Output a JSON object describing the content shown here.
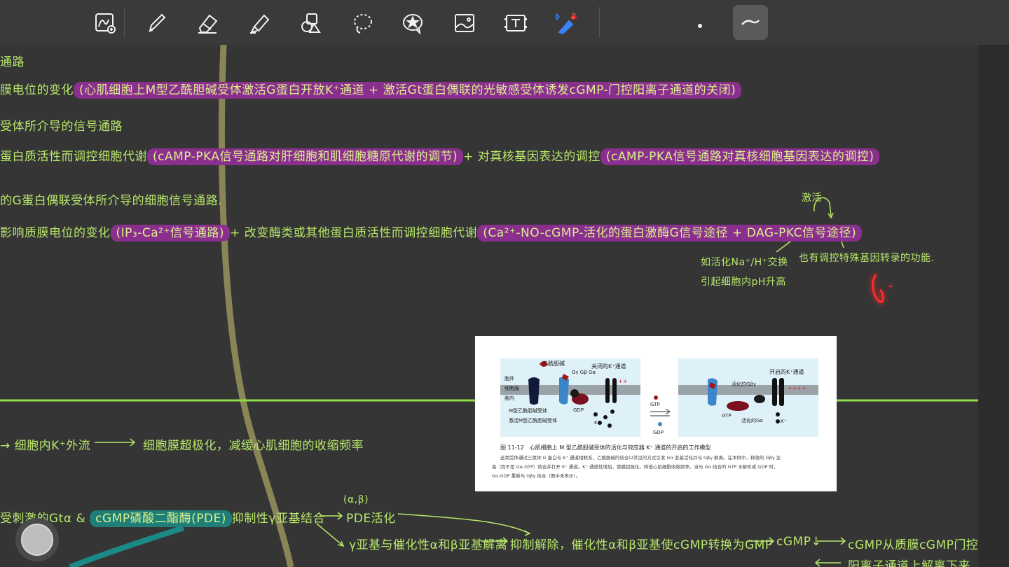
{
  "toolbar": {
    "tools": [
      {
        "name": "lasso-zoom-tool-icon"
      },
      {
        "name": "pen-tool-icon"
      },
      {
        "name": "eraser-tool-icon"
      },
      {
        "name": "highlighter-tool-icon"
      },
      {
        "name": "shapes-tool-icon"
      },
      {
        "name": "lasso-tool-icon"
      },
      {
        "name": "sticker-tool-icon"
      },
      {
        "name": "image-tool-icon"
      },
      {
        "name": "text-tool-icon"
      },
      {
        "name": "laser-pointer-tool-icon"
      }
    ],
    "colors": {
      "background": "#3a3a3a",
      "icon": "#f2f2f2",
      "laser_red": "#ff3b30",
      "laser_blue": "#3b82f6"
    }
  },
  "notes": {
    "line1": "通路",
    "line2_prefix": "膜电位的变化",
    "line2_hl": "(心肌细胞上M型乙酰胆碱受体激活G蛋白开放K⁺通道 + 激活Gt蛋白偶联的光敏感受体诱发cGMP-门控阳离子通道的关闭)",
    "line3": "受体所介导的信号通路",
    "line4_prefix": "蛋白质活性而调控细胞代谢",
    "line4_hl1": "(cAMP-PKA信号通路对肝细胞和肌细胞糖原代谢的调节)",
    "line4_mid": "+ 对真核基因表达的调控",
    "line4_hl2": "(cAMP-PKA信号通路对真核细胞基因表达的调控)",
    "line5": "的G蛋白偶联受体所介导的细胞信号通路.",
    "line6_prefix": "影响质膜电位的变化",
    "line6_hl1": "(IP₃-Ca²⁺信号通路)",
    "line6_mid": "+ 改变酶类或其他蛋白质活性而调控细胞代谢",
    "line6_hl2": "(Ca²⁺-NO-cGMP-活化的蛋白激酶G信号途径 + DAG-PKC信号途径)",
    "activate_label": "激活",
    "branch1_a": "如活化Na⁺/H⁺交换",
    "branch1_b": "引起细胞内pH升高",
    "branch2": "也有调控特殊基因转录的功能.",
    "lower1_a": "→ 细胞内K⁺外流",
    "lower1_b": "细胞膜超极化，减缓心肌细胞的收缩频率",
    "lower2_a": "受刺激的Gtα",
    "lower2_amp": "&",
    "lower2_hl": "cGMP磷酸二酯酶(PDE)",
    "lower2_b": "抑制性γ亚基结合",
    "lower2_ab": "(α,β)",
    "lower2_c": "PDE活化",
    "lower3_a": "γ亚基与催化性α和β亚基解离",
    "lower3_b": "抑制解除，催化性α和β亚基使cGMP转换为GMP",
    "lower3_c": "cGMP↓",
    "lower3_d": "cGMP从质膜cGMP门控",
    "lower4_a": "阳离子通道上解离下来"
  },
  "figure": {
    "left": {
      "extracellular": "胞外",
      "membrane": "细胞膜",
      "intracellular": "胞内",
      "ligand": "乙酰胆碱",
      "closed_channel": "关闭的K⁺通道",
      "gproteins": "Gγ Gβ Gα",
      "receptor": "M型乙酰胆碱受体",
      "active_receptor": "激活M型乙酰胆碱受体",
      "gdp": "GDP",
      "k": "K⁺",
      "charge_top": "++",
      "charge_bot": "--"
    },
    "center": {
      "gtp": "GTP",
      "gdp": "GDP"
    },
    "right": {
      "open_channel": "开启的K⁺通道",
      "active_gbg": "活化的Gβγ",
      "gtp": "GTP",
      "active_ga": "活化的Gα",
      "k": "K⁺",
      "charge_top": "++++",
      "charge_bot": "----"
    },
    "caption_title": "图 11-12　心肌细胞上 M 型乙酰胆碱受体的活化与效应器 K⁺ 通道的开启的工作模型",
    "caption_l1": "这类受体通过三聚体 G 蛋白与 K⁺ 通道相联系，乙酰胆碱的结合以常见的方式引发 Gα 亚基活化并与 Gβγ 解离。在本例中，释放的 Gβγ 亚",
    "caption_l2": "基（而不是 Gα-GTP）结合并打开 K⁺ 通道。K⁺ 通透性增加，使膜超极化，降低心肌细胞收缩频率。当与 Gα 结合的 GTP 水解形成 GDP 时，",
    "caption_l3": "Gα-GDP 重新与 Gβγ 结合（图中未表示）。"
  },
  "colors": {
    "ink_green": "#b8e86a",
    "highlight_purple": "#8b2f8f",
    "highlight_teal": "#1f7f78",
    "divider_green": "#8ee04a",
    "olive_stroke": "#8f8a5a",
    "teal_stroke": "#1a8a86",
    "red_scribble": "#ff2a2a"
  }
}
